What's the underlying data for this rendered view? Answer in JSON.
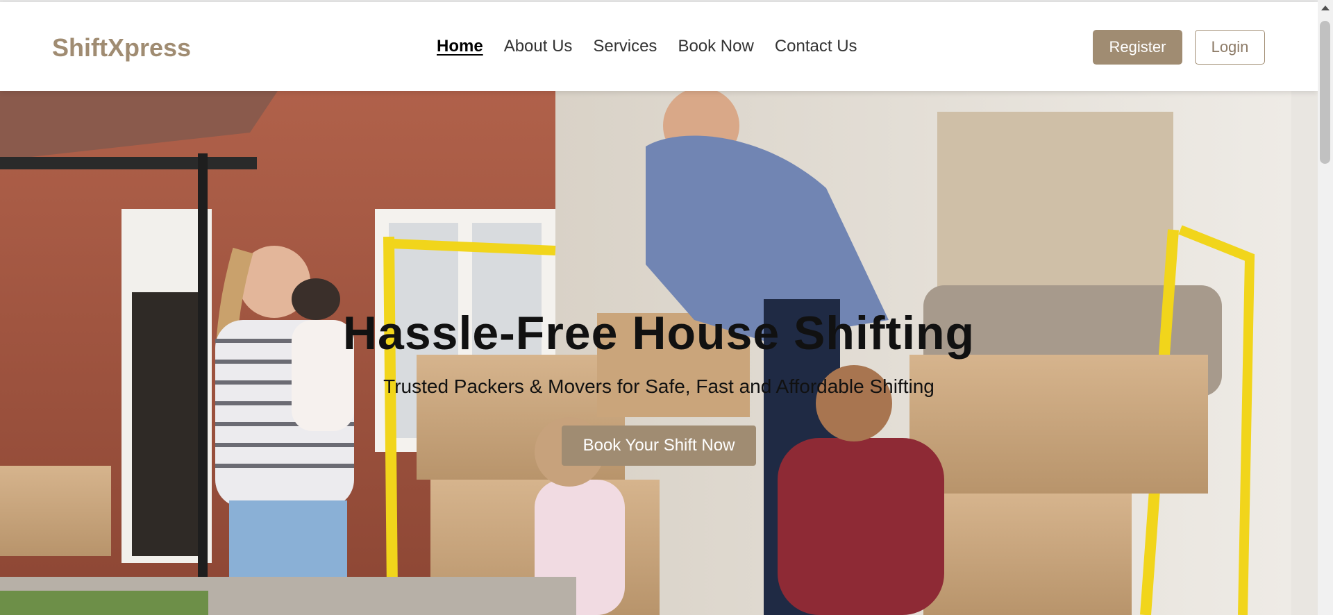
{
  "header": {
    "brand": "ShiftXpress",
    "nav": [
      {
        "label": "Home",
        "active": true
      },
      {
        "label": "About Us",
        "active": false
      },
      {
        "label": "Services",
        "active": false
      },
      {
        "label": "Book Now",
        "active": false
      },
      {
        "label": "Contact Us",
        "active": false
      }
    ],
    "register_label": "Register",
    "login_label": "Login"
  },
  "hero": {
    "title": "Hassle-Free House Shifting",
    "subtitle": "Trusted Packers & Movers for Safe, Fast and Affordable Shifting",
    "cta_label": "Book Your Shift Now",
    "image_description": "family-moving-boxes-photo"
  },
  "colors": {
    "accent": "#a08c72",
    "text": "#111111"
  }
}
